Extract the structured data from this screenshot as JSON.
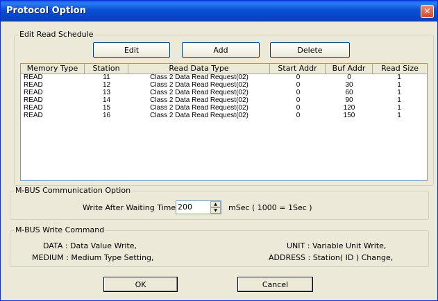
{
  "window": {
    "title": "Protocol Option",
    "close_glyph": "✕"
  },
  "read_schedule": {
    "legend": "Edit Read Schedule",
    "buttons": {
      "edit": "Edit",
      "add": "Add",
      "delete": "Delete"
    },
    "columns": [
      "Memory Type",
      "Station",
      "Read Data Type",
      "Start Addr",
      "Buf Addr",
      "Read Size"
    ],
    "rows": [
      [
        "READ",
        "11",
        "Class 2 Data Read Request(02)",
        "0",
        "0",
        "1"
      ],
      [
        "READ",
        "12",
        "Class 2 Data Read Request(02)",
        "0",
        "30",
        "1"
      ],
      [
        "READ",
        "13",
        "Class 2 Data Read Request(02)",
        "0",
        "60",
        "1"
      ],
      [
        "READ",
        "14",
        "Class 2 Data Read Request(02)",
        "0",
        "90",
        "1"
      ],
      [
        "READ",
        "15",
        "Class 2 Data Read Request(02)",
        "0",
        "120",
        "1"
      ],
      [
        "READ",
        "16",
        "Class 2 Data Read Request(02)",
        "0",
        "150",
        "1"
      ]
    ]
  },
  "comm_option": {
    "legend": "M-BUS Communication Option",
    "wait_label": "Write After Waiting Time :",
    "wait_value": "200",
    "unit_label": "mSec ( 1000 = 1Sec )"
  },
  "write_command": {
    "legend": "M-BUS Write Command",
    "data": "DATA : Data Value Write,",
    "medium": "MEDIUM : Medium Type Setting,",
    "unit": "UNIT : Variable Unit Write,",
    "address": "ADDRESS : Station( ID ) Change,"
  },
  "footer": {
    "ok": "OK",
    "cancel": "Cancel"
  }
}
